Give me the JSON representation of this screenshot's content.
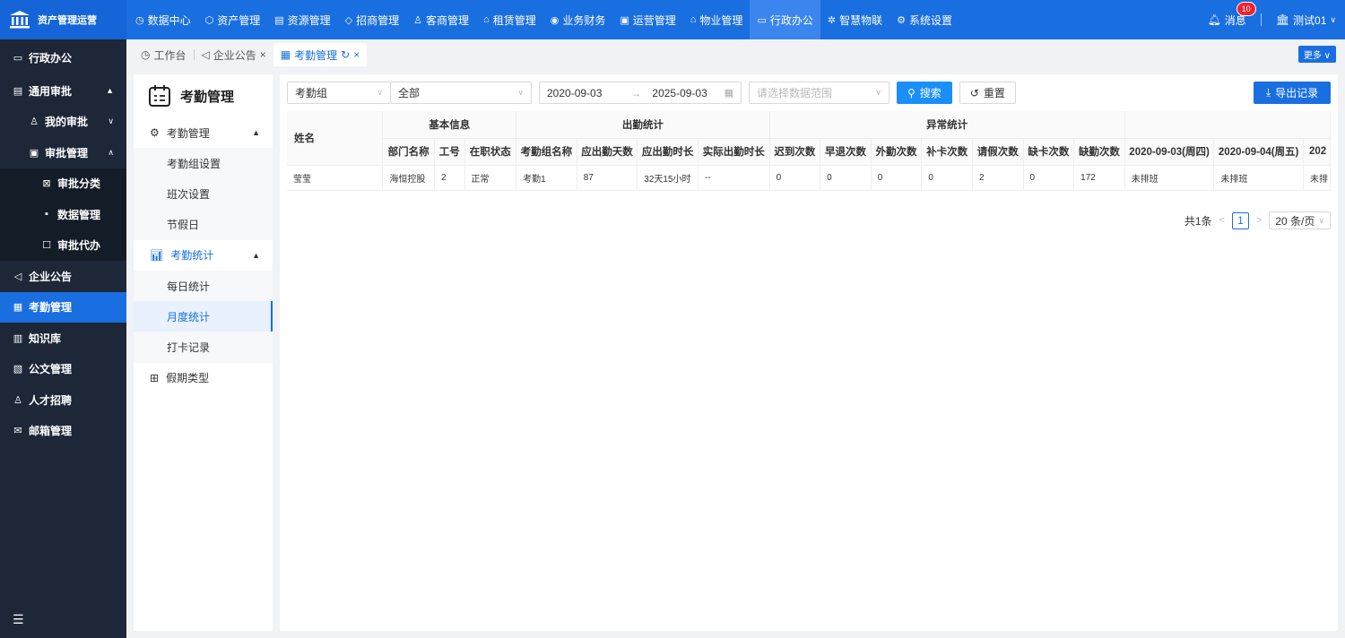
{
  "app": {
    "brand": "资产管理运营"
  },
  "topnav": {
    "items": [
      {
        "label": "数据中心",
        "icon": "◷"
      },
      {
        "label": "资产管理",
        "icon": "⬡"
      },
      {
        "label": "资源管理",
        "icon": "▤"
      },
      {
        "label": "招商管理",
        "icon": "◇"
      },
      {
        "label": "客商管理",
        "icon": "♙"
      },
      {
        "label": "租赁管理",
        "icon": "⌂"
      },
      {
        "label": "业务财务",
        "icon": "◉"
      },
      {
        "label": "运营管理",
        "icon": "▣"
      },
      {
        "label": "物业管理",
        "icon": "⌂"
      },
      {
        "label": "行政办公",
        "icon": "▭"
      },
      {
        "label": "智慧物联",
        "icon": "✲"
      },
      {
        "label": "系统设置",
        "icon": "⚙"
      }
    ],
    "messages_label": "消息",
    "message_count": "10",
    "user": "测试01"
  },
  "sidebar": {
    "section": "行政办公",
    "items": [
      {
        "label": "通用审批"
      },
      {
        "label": "我的审批"
      },
      {
        "label": "审批管理"
      },
      {
        "label": "审批分类"
      },
      {
        "label": "数据管理"
      },
      {
        "label": "审批代办"
      },
      {
        "label": "企业公告"
      },
      {
        "label": "考勤管理"
      },
      {
        "label": "知识库"
      },
      {
        "label": "公文管理"
      },
      {
        "label": "人才招聘"
      },
      {
        "label": "邮箱管理"
      }
    ]
  },
  "tabs": [
    {
      "label": "工作台"
    },
    {
      "label": "企业公告"
    },
    {
      "label": "考勤管理"
    }
  ],
  "more_label": "更多",
  "submenu": {
    "title": "考勤管理",
    "groups": [
      {
        "label": "考勤管理",
        "children": [
          "考勤组设置",
          "班次设置",
          "节假日"
        ]
      },
      {
        "label": "考勤统计",
        "children": [
          "每日统计",
          "月度统计",
          "打卡记录"
        ]
      },
      {
        "label": "假期类型",
        "children": []
      }
    ]
  },
  "filters": {
    "group_select": "考勤组",
    "scope_select": "全部",
    "date_start": "2020-09-03",
    "date_end": "2025-09-03",
    "range_placeholder": "请选择数据范围",
    "search_label": "搜索",
    "reset_label": "重置",
    "export_label": "导出记录"
  },
  "table": {
    "name_header": "姓名",
    "groups": [
      "基本信息",
      "出勤统计",
      "异常统计"
    ],
    "columns": [
      "部门名称",
      "工号",
      "在职状态",
      "考勤组名称",
      "应出勤天数",
      "应出勤时长",
      "实际出勤时长",
      "迟到次数",
      "早退次数",
      "外勤次数",
      "补卡次数",
      "请假次数",
      "缺卡次数",
      "缺勤次数",
      "2020-09-03(周四)",
      "2020-09-04(周五)",
      "202"
    ],
    "rows": [
      [
        "莹莹",
        "海恒控股",
        "2",
        "正常",
        "考勤1",
        "87",
        "32天15小时",
        "--",
        "0",
        "0",
        "0",
        "0",
        "2",
        "0",
        "172",
        "未排班",
        "未排班",
        "未排"
      ]
    ]
  },
  "pager": {
    "total": "共1条",
    "current": "1",
    "page_size": "20 条/页"
  }
}
